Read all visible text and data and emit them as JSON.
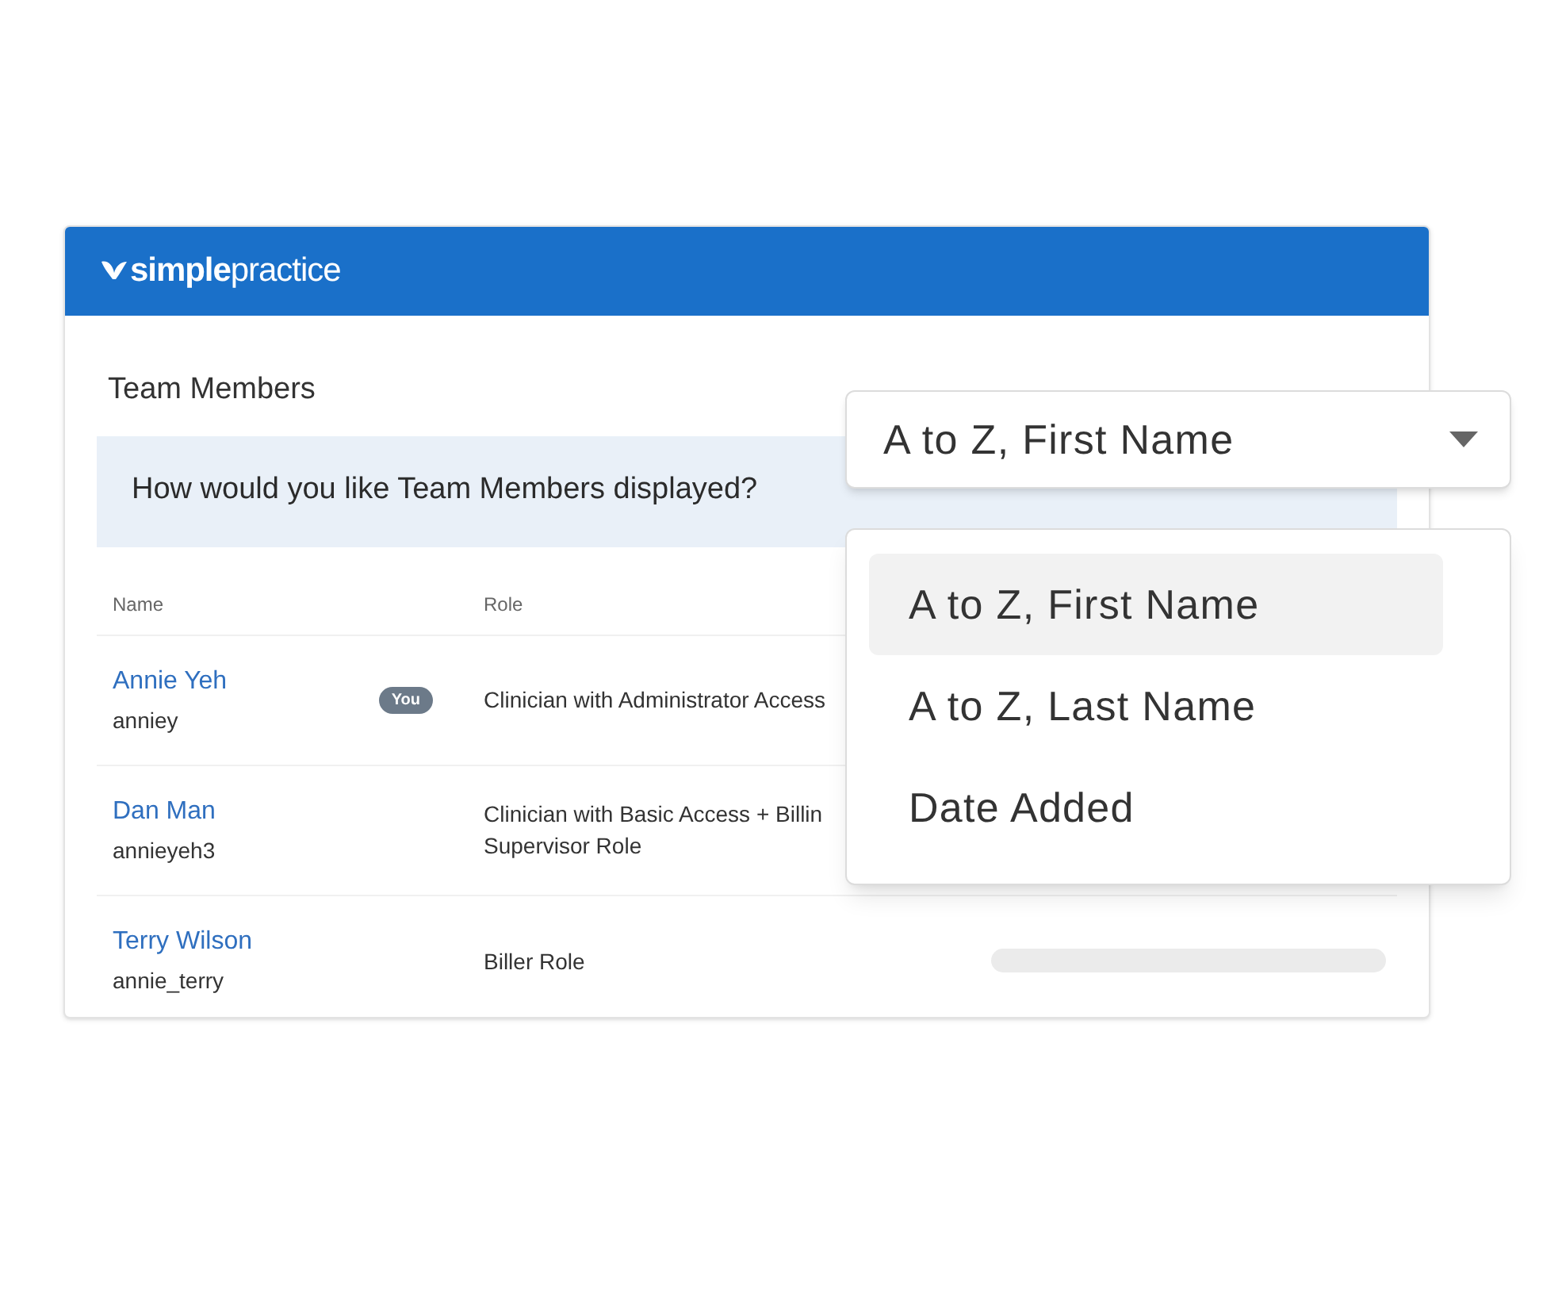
{
  "header": {
    "logo": "**simple**practice"
  },
  "title": "Team Members",
  "banner": "How would you like Team Members displayed?",
  "table": {
    "columns": [
      "Name",
      "Role"
    ],
    "rows": [
      {
        "name": "Annie Yeh",
        "username": "anniey",
        "badge": "You",
        "role_lines": [
          "Clinician with Administrator Access"
        ]
      },
      {
        "name": "Dan Man",
        "username": "annieyeh3",
        "role_lines": [
          "Clinician with Basic Access + Billin",
          "Supervisor Role"
        ]
      },
      {
        "name": "Terry Wilson",
        "username": "annie_terry",
        "role_lines": [
          "Biller Role"
        ],
        "loading": true
      }
    ]
  },
  "sort_select": {
    "value": "A to Z, First Name"
  },
  "sort_menu": [
    {
      "label": "A to Z, First Name",
      "selected": true
    },
    {
      "label": "A to Z, Last Name",
      "selected": false
    },
    {
      "label": "Date Added",
      "selected": false
    }
  ]
}
